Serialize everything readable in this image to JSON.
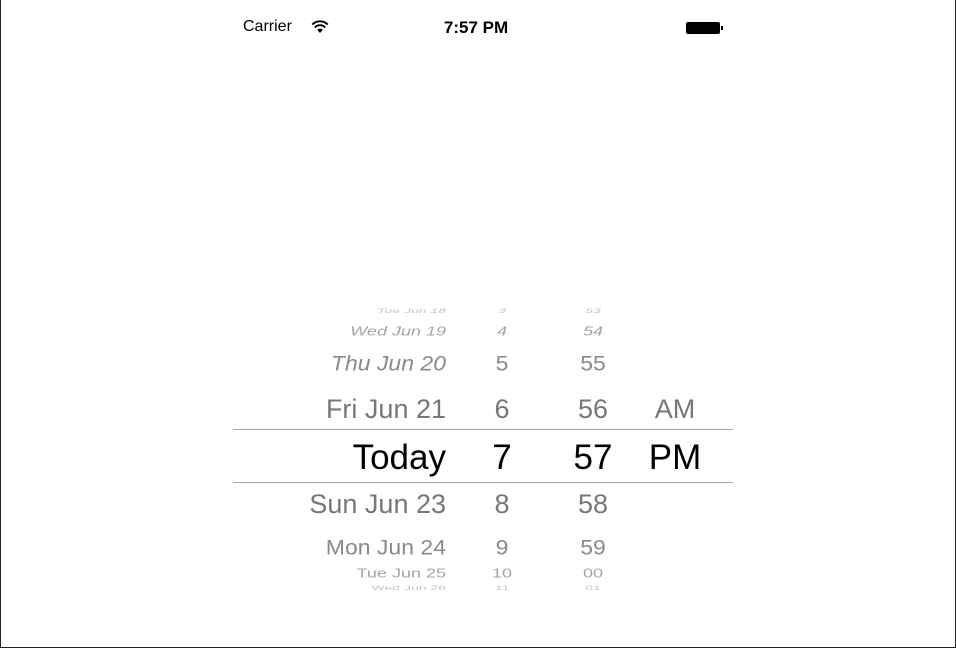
{
  "status_bar": {
    "carrier": "Carrier",
    "time": "7:57 PM",
    "wifi_icon": "wifi-icon",
    "battery_icon": "battery-icon"
  },
  "date_picker": {
    "dates": [
      "Tue Jun 18",
      "Wed Jun 19",
      "Thu Jun 20",
      "Fri Jun 21",
      "Today",
      "Sun Jun 23",
      "Mon Jun 24",
      "Tue Jun 25",
      "Wed Jun 26"
    ],
    "hours": [
      "3",
      "4",
      "5",
      "6",
      "7",
      "8",
      "9",
      "10",
      "11"
    ],
    "minutes": [
      "53",
      "54",
      "55",
      "56",
      "57",
      "58",
      "59",
      "00",
      "01"
    ],
    "ampm": [
      "",
      "",
      "",
      "AM",
      "PM",
      "",
      "",
      "",
      ""
    ],
    "selected": {
      "date": "Today",
      "hour": "7",
      "minute": "57",
      "ampm": "PM"
    }
  }
}
